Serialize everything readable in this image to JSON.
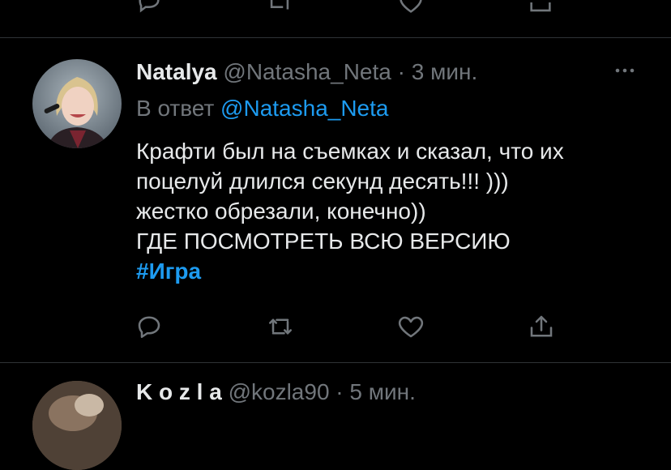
{
  "tweet": {
    "display_name": "Natalya",
    "handle": "@Natasha_Neta",
    "separator": "·",
    "time": "3 мин.",
    "reply_prefix": "В ответ",
    "reply_to": "@Natasha_Neta",
    "text_lines": [
      "Крафти был на съемках и сказал, что их",
      "поцелуй длился секунд десять!!! )))",
      "жестко обрезали, конечно))",
      "ГДЕ ПОСМОТРЕТЬ ВСЮ ВЕРСИЮ"
    ],
    "hashtag": "#Игра",
    "more_icon": "more-horizontal-icon"
  },
  "actions": {
    "reply_icon": "reply-icon",
    "retweet_icon": "retweet-icon",
    "like_icon": "heart-icon",
    "share_icon": "share-icon"
  },
  "next_tweet": {
    "display_name": "K o z l a",
    "handle": "@kozla90",
    "separator": "·",
    "time": "5 мин."
  },
  "colors": {
    "background": "#000000",
    "text": "#e7e9ea",
    "secondary": "#71767b",
    "accent": "#1d9bf0",
    "divider": "#2f3336"
  }
}
